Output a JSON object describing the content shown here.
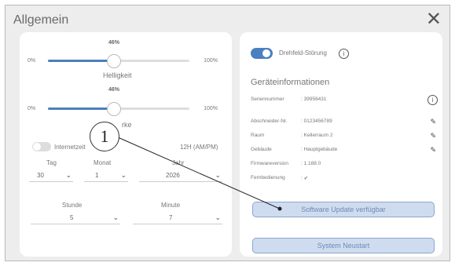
{
  "dialog": {
    "title": "Allgemein",
    "close_icon": "close-icon"
  },
  "brightness": {
    "percent_label": "46%",
    "value": 0.46,
    "min": "0%",
    "max": "100%",
    "label": "Helligkeit"
  },
  "volume": {
    "percent_label": "46%",
    "value": 0.46,
    "min": "0%",
    "max": "100%",
    "label_partial": "rke"
  },
  "internet_time": {
    "label": "Internetzeit",
    "format": "12H (AM/PM)",
    "enabled": false
  },
  "date": {
    "day_label": "Tag",
    "month_label": "Monat",
    "year_label": "Jahr",
    "day": "30",
    "month": "1",
    "year": "2026"
  },
  "time": {
    "hour_label": "Stunde",
    "minute_label": "Minute",
    "hour": "5",
    "minute": "7"
  },
  "rotary_field_error": {
    "label": "Drehfeld-Störung",
    "enabled": true
  },
  "device_info": {
    "title": "Geräteinformationen",
    "serial": {
      "key": "Seriennummer",
      "value": ": 39956431"
    },
    "rows": [
      {
        "key": "Abschneider-Nr.",
        "value": ": 0123456789"
      },
      {
        "key": "Raum",
        "value": ": Kellerraum 2"
      },
      {
        "key": "Gebäude",
        "value": ": Hauptgebäude"
      },
      {
        "key": "Firmwareversion",
        "value": ": 1.188.0"
      },
      {
        "key": "Fernbedienung",
        "value": ": ✔"
      }
    ]
  },
  "buttons": {
    "software_update": "Software Update verfügbar",
    "restart": "System Neustart"
  },
  "callout": {
    "number": "1"
  }
}
